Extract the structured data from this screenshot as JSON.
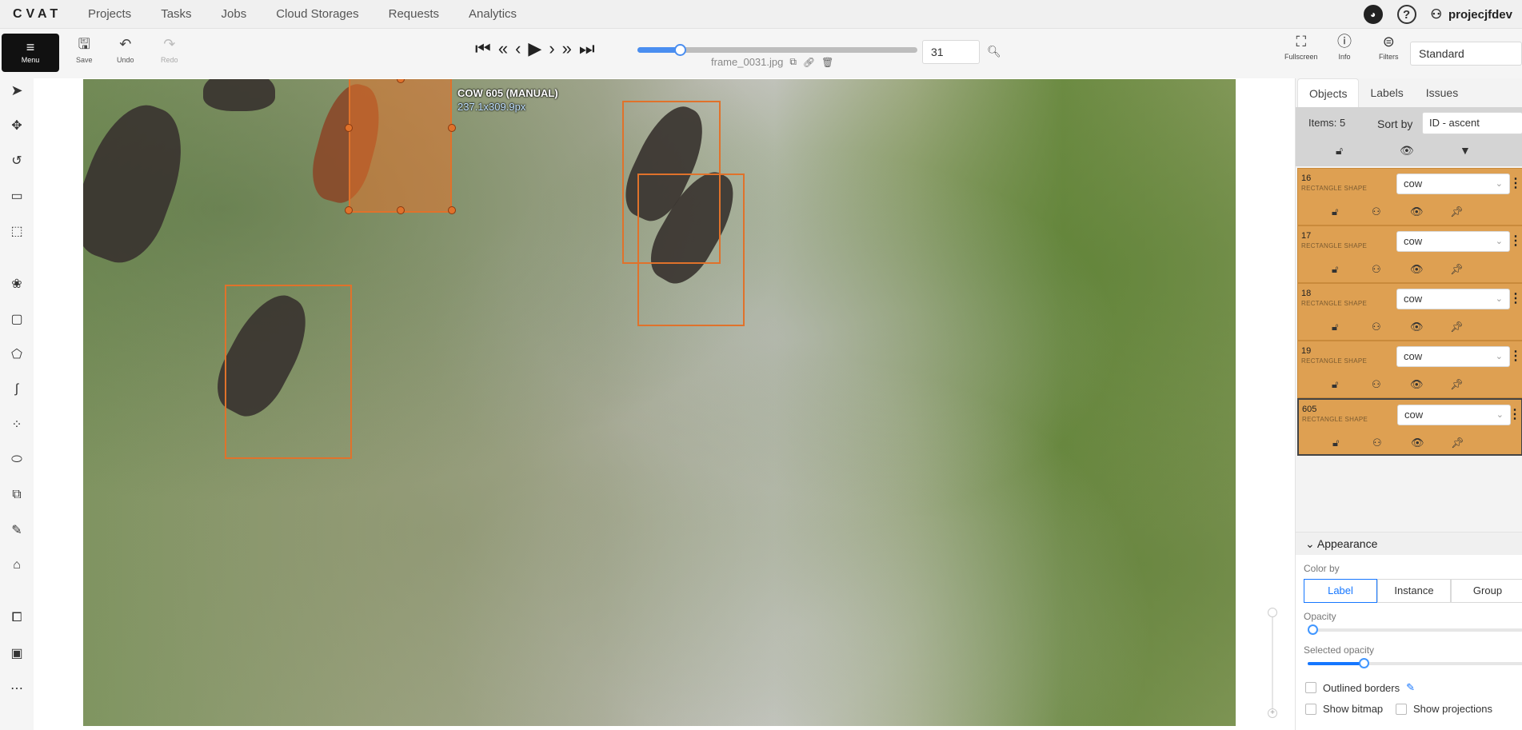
{
  "topnav": {
    "logo": "CVAT",
    "links": [
      "Projects",
      "Tasks",
      "Jobs",
      "Cloud Storages",
      "Requests",
      "Analytics"
    ],
    "username": "projecjfdev",
    "github_icon": "github-icon",
    "help_icon": "help-icon",
    "user_icon": "user-icon"
  },
  "toolbar": {
    "menu_label": "Menu",
    "save_label": "Save",
    "undo_label": "Undo",
    "redo_label": "Redo",
    "frame_number": "31",
    "frame_name": "frame_0031.jpg",
    "slider_progress_percent": 15,
    "fullscreen_label": "Fullscreen",
    "info_label": "Info",
    "filters_label": "Filters",
    "workspace_mode": "Standard"
  },
  "canvas": {
    "active_shape_label": "COW 605 (MANUAL)",
    "active_shape_size": "237.1x309.9px",
    "annotation_color": "#e0722b"
  },
  "sidebar": {
    "tabs": [
      "Objects",
      "Labels",
      "Issues"
    ],
    "items_count": "Items: 5",
    "sort_by_label": "Sort by",
    "sort_value": "ID - ascent",
    "objects": [
      {
        "id": "16",
        "type": "RECTANGLE SHAPE",
        "label": "cow"
      },
      {
        "id": "17",
        "type": "RECTANGLE SHAPE",
        "label": "cow"
      },
      {
        "id": "18",
        "type": "RECTANGLE SHAPE",
        "label": "cow"
      },
      {
        "id": "19",
        "type": "RECTANGLE SHAPE",
        "label": "cow"
      },
      {
        "id": "605",
        "type": "RECTANGLE SHAPE",
        "label": "cow"
      }
    ],
    "card_color": "#dea052"
  },
  "appearance": {
    "title": "Appearance",
    "color_by_label": "Color by",
    "color_by_options": [
      "Label",
      "Instance",
      "Group"
    ],
    "color_by_selected": "Label",
    "opacity_label": "Opacity",
    "opacity_value": 0,
    "selected_opacity_label": "Selected opacity",
    "selected_opacity_value": 0.26,
    "outlined_borders_label": "Outlined borders",
    "show_bitmap_label": "Show bitmap",
    "show_projections_label": "Show projections"
  }
}
